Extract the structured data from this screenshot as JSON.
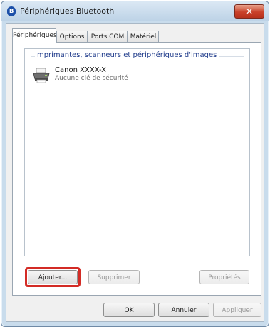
{
  "window": {
    "title": "Périphériques Bluetooth",
    "bluetooth_glyph": "ʙ",
    "close_glyph": "✕"
  },
  "tabs": [
    {
      "label": "Périphériques",
      "active": true
    },
    {
      "label": "Options",
      "active": false
    },
    {
      "label": "Ports COM",
      "active": false
    },
    {
      "label": "Matériel",
      "active": false
    }
  ],
  "device_list": {
    "group_title": "Imprimantes, scanneurs et périphériques d'images",
    "devices": [
      {
        "name": "Canon XXXX-X",
        "status": "Aucune clé de sécurité",
        "icon": "printer-icon"
      }
    ]
  },
  "panel_buttons": {
    "add": "Ajouter...",
    "remove": "Supprimer",
    "properties": "Propriétés"
  },
  "dialog_buttons": {
    "ok": "OK",
    "cancel": "Annuler",
    "apply": "Appliquer"
  },
  "colors": {
    "highlight": "#d32b25",
    "bluetooth": "#1b4fa8"
  }
}
